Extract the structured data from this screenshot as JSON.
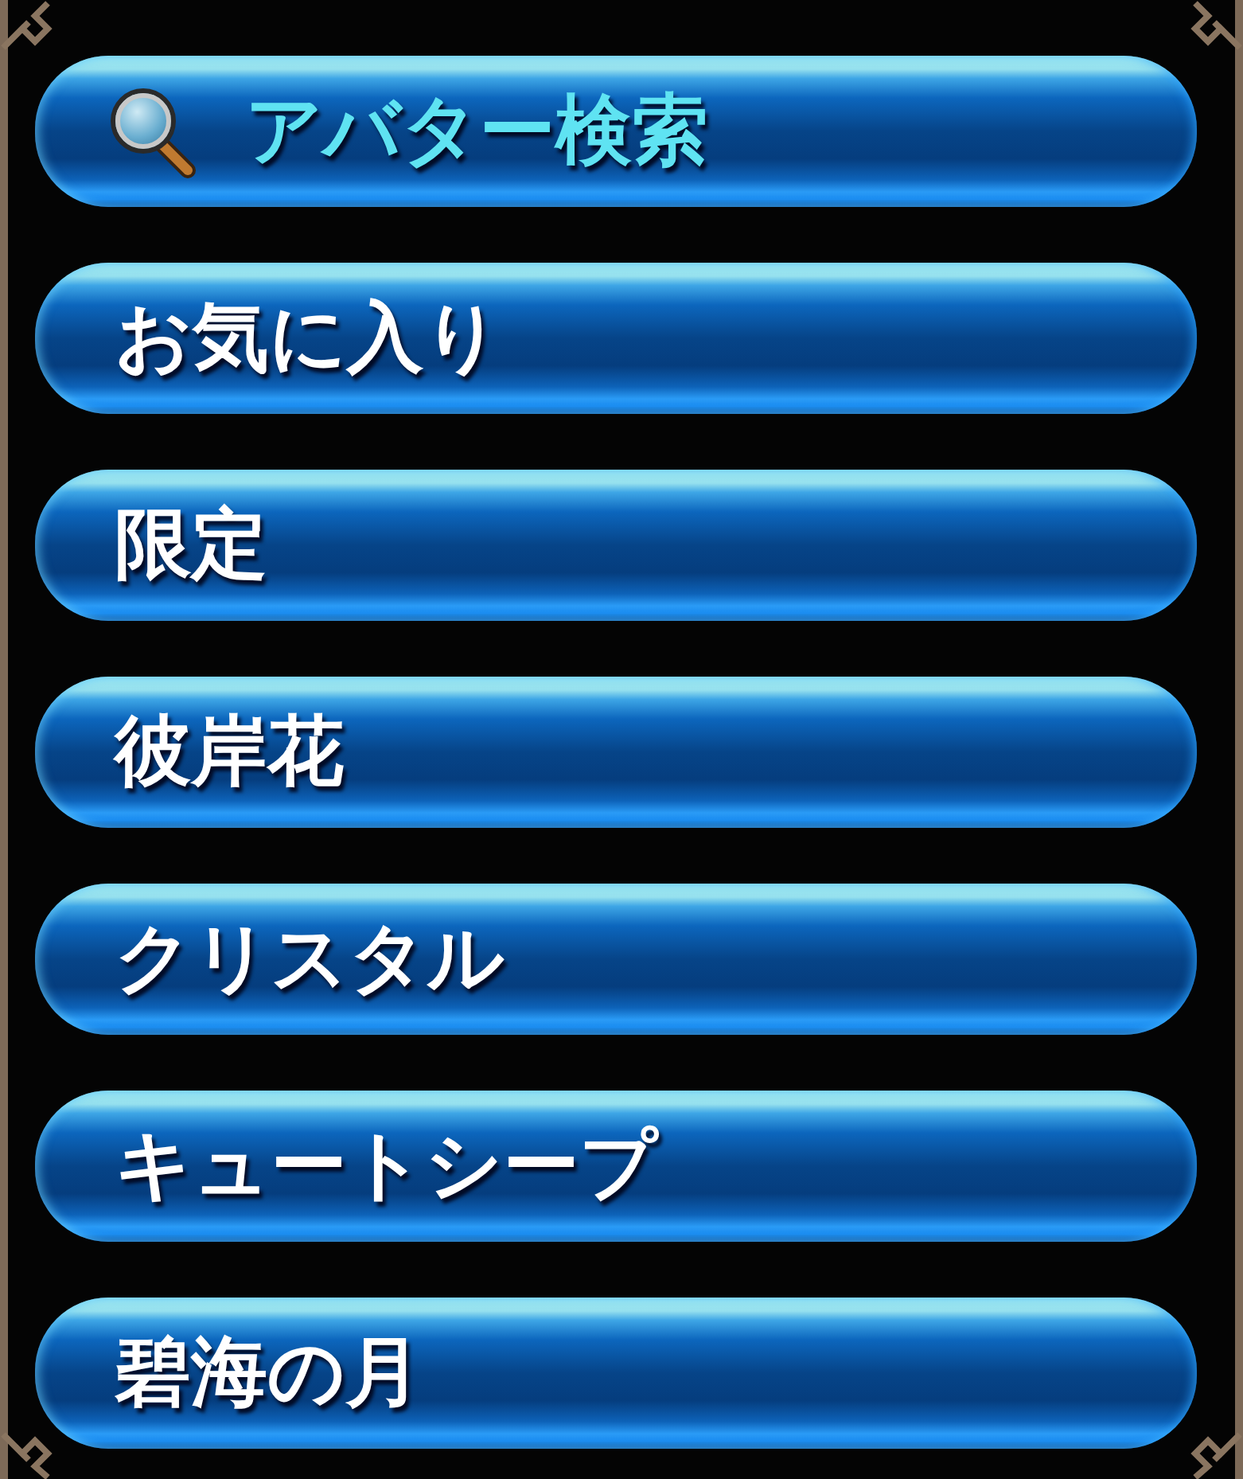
{
  "menu": {
    "items": [
      {
        "kind": "search",
        "label": "アバター検索"
      },
      {
        "kind": "category",
        "label": "お気に入り"
      },
      {
        "kind": "category",
        "label": "限定"
      },
      {
        "kind": "category",
        "label": "彼岸花"
      },
      {
        "kind": "category",
        "label": "クリスタル"
      },
      {
        "kind": "category",
        "label": "キュートシープ"
      },
      {
        "kind": "category",
        "label": "碧海の月"
      }
    ]
  }
}
